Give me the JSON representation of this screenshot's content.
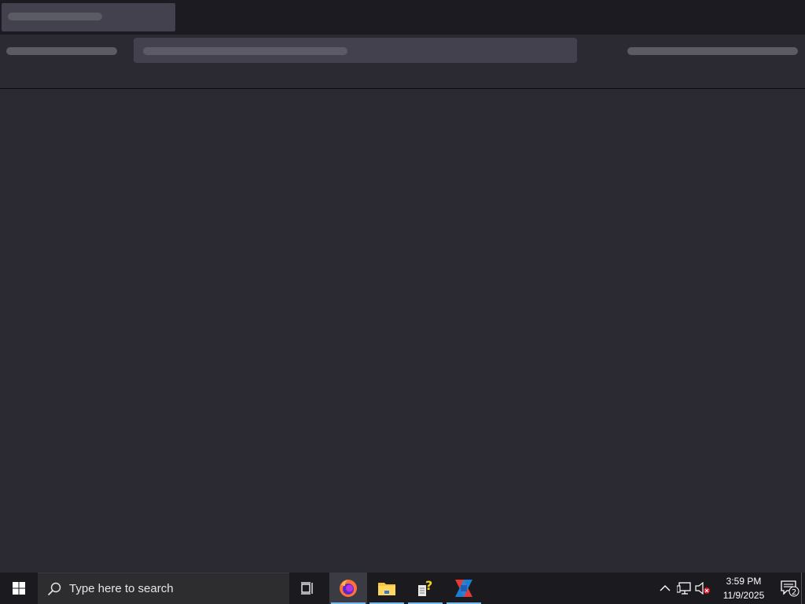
{
  "taskbar": {
    "search_placeholder": "Type here to search",
    "apps": [
      {
        "name": "firefox",
        "icon": "firefox-icon",
        "active": true
      },
      {
        "name": "file-explorer",
        "icon": "folder-icon",
        "active": false
      },
      {
        "name": "help",
        "icon": "help-icon",
        "active": false
      },
      {
        "name": "ide",
        "icon": "ide-icon",
        "active": false
      }
    ],
    "clock": {
      "time": "3:59 PM",
      "date": "11/9/2025"
    },
    "notification_count": "2",
    "accent_color": "#76b9ed"
  },
  "browser": {
    "theme_color": "#2b2a33",
    "loading": true
  }
}
